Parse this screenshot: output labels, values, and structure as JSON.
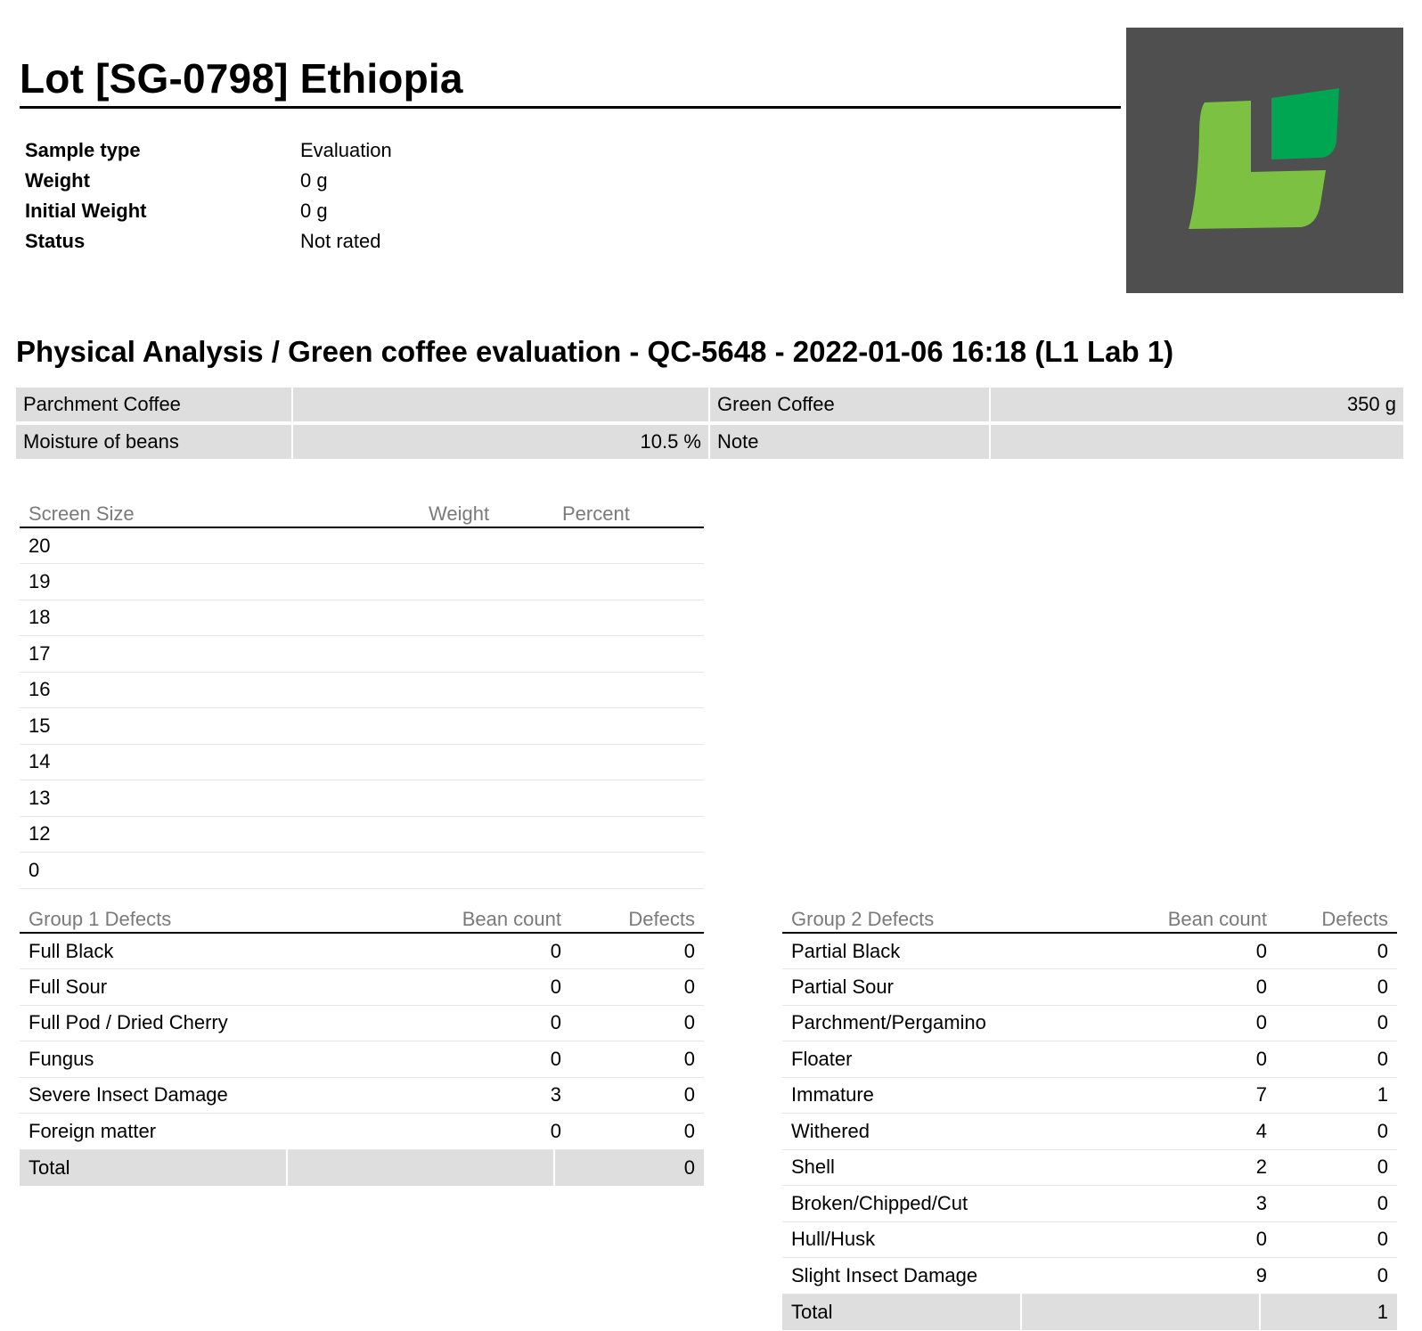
{
  "header": {
    "title": "Lot [SG-0798] Ethiopia"
  },
  "meta": [
    {
      "label": "Sample type",
      "value": "Evaluation"
    },
    {
      "label": "Weight",
      "value": "0 g"
    },
    {
      "label": "Initial Weight",
      "value": "0 g"
    },
    {
      "label": "Status",
      "value": "Not rated"
    }
  ],
  "logo": {
    "icon": "leaf-logo-icon",
    "background": "#4f4f4f",
    "light_green": "#7dc142",
    "dark_green": "#00a651"
  },
  "analysis": {
    "title": "Physical Analysis / Green coffee evaluation - QC-5648 - 2022-01-06 16:18 (L1 Lab 1)",
    "rows": [
      {
        "label1": "Parchment Coffee",
        "value1": "",
        "label2": "Green Coffee",
        "value2": "350 g"
      },
      {
        "label1": "Moisture of beans",
        "value1": "10.5 %",
        "label2": "Note",
        "value2": ""
      }
    ]
  },
  "screen_size": {
    "headers": [
      "Screen Size",
      "Weight",
      "Percent"
    ],
    "rows": [
      {
        "size": "20",
        "weight": "",
        "percent": ""
      },
      {
        "size": "19",
        "weight": "",
        "percent": ""
      },
      {
        "size": "18",
        "weight": "",
        "percent": ""
      },
      {
        "size": "17",
        "weight": "",
        "percent": ""
      },
      {
        "size": "16",
        "weight": "",
        "percent": ""
      },
      {
        "size": "15",
        "weight": "",
        "percent": ""
      },
      {
        "size": "14",
        "weight": "",
        "percent": ""
      },
      {
        "size": "13",
        "weight": "",
        "percent": ""
      },
      {
        "size": "12",
        "weight": "",
        "percent": ""
      },
      {
        "size": "0",
        "weight": "",
        "percent": ""
      }
    ]
  },
  "group1": {
    "headers": [
      "Group 1 Defects",
      "",
      "Bean count",
      "Defects"
    ],
    "rows": [
      {
        "name": "Full Black",
        "bean_count": "0",
        "defects": "0"
      },
      {
        "name": "Full Sour",
        "bean_count": "0",
        "defects": "0"
      },
      {
        "name": "Full Pod / Dried Cherry",
        "bean_count": "0",
        "defects": "0"
      },
      {
        "name": "Fungus",
        "bean_count": "0",
        "defects": "0"
      },
      {
        "name": "Severe Insect Damage",
        "bean_count": "3",
        "defects": "0"
      },
      {
        "name": "Foreign matter",
        "bean_count": "0",
        "defects": "0"
      }
    ],
    "total": {
      "label": "Total",
      "bean_count": "",
      "defects": "0"
    }
  },
  "group2": {
    "headers": [
      "Group 2 Defects",
      "",
      "Bean count",
      "Defects"
    ],
    "rows": [
      {
        "name": "Partial Black",
        "bean_count": "0",
        "defects": "0"
      },
      {
        "name": "Partial Sour",
        "bean_count": "0",
        "defects": "0"
      },
      {
        "name": "Parchment/Pergamino",
        "bean_count": "0",
        "defects": "0"
      },
      {
        "name": "Floater",
        "bean_count": "0",
        "defects": "0"
      },
      {
        "name": "Immature",
        "bean_count": "7",
        "defects": "1"
      },
      {
        "name": "Withered",
        "bean_count": "4",
        "defects": "0"
      },
      {
        "name": "Shell",
        "bean_count": "2",
        "defects": "0"
      },
      {
        "name": "Broken/Chipped/Cut",
        "bean_count": "3",
        "defects": "0"
      },
      {
        "name": "Hull/Husk",
        "bean_count": "0",
        "defects": "0"
      },
      {
        "name": "Slight Insect Damage",
        "bean_count": "9",
        "defects": "0"
      }
    ],
    "total": {
      "label": "Total",
      "bean_count": "",
      "defects": "1"
    }
  }
}
